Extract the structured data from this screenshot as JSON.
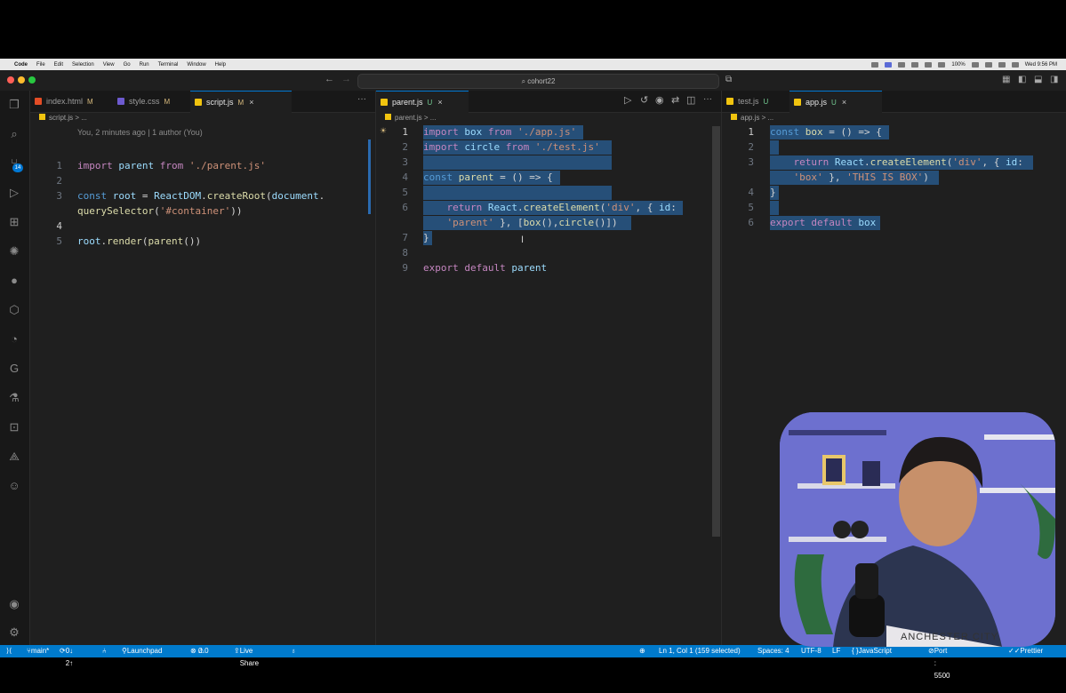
{
  "menubar": {
    "app": "Code",
    "items": [
      "File",
      "Edit",
      "Selection",
      "View",
      "Go",
      "Run",
      "Terminal",
      "Window",
      "Help"
    ],
    "battery": "100%",
    "clock": "Wed 9:56 PM"
  },
  "titlebar": {
    "search": "cohort22"
  },
  "panes": {
    "left": {
      "tabs": [
        {
          "label": "index.html",
          "mark": "M"
        },
        {
          "label": "style.css",
          "mark": "M"
        },
        {
          "label": "script.js",
          "mark": "M"
        }
      ],
      "breadcrumb": "script.js > ...",
      "blame": "You, 2 minutes ago | 1 author (You)",
      "line_numbers": [
        "1",
        "2",
        "3",
        "",
        "4",
        "5"
      ]
    },
    "middle": {
      "tabs": [
        {
          "label": "parent.js",
          "mark": "U"
        }
      ],
      "breadcrumb": "parent.js > ...",
      "line_numbers": [
        "1",
        "2",
        "3",
        "4",
        "5",
        "6",
        "",
        "7",
        "8",
        "9"
      ]
    },
    "right": {
      "tabs": [
        {
          "label": "test.js",
          "mark": "U"
        },
        {
          "label": "app.js",
          "mark": "U"
        }
      ],
      "breadcrumb": "app.js > ...",
      "line_numbers": [
        "1",
        "2",
        "3",
        "",
        "4",
        "5",
        "6"
      ]
    }
  },
  "code": {
    "script": [
      [
        {
          "t": "import ",
          "c": "kw2"
        },
        {
          "t": "parent ",
          "c": "var"
        },
        {
          "t": "from ",
          "c": "kw2"
        },
        {
          "t": "'./parent.js'",
          "c": "str"
        }
      ],
      [],
      [
        {
          "t": "const ",
          "c": "kw"
        },
        {
          "t": "root ",
          "c": "var"
        },
        {
          "t": "= ",
          "c": "op"
        },
        {
          "t": "ReactDOM",
          "c": "var"
        },
        {
          "t": ".",
          "c": "op"
        },
        {
          "t": "createRoot",
          "c": "fn"
        },
        {
          "t": "(",
          "c": "op"
        },
        {
          "t": "document",
          "c": "var"
        },
        {
          "t": ".",
          "c": "op"
        }
      ],
      [
        {
          "t": "querySelector",
          "c": "fn"
        },
        {
          "t": "(",
          "c": "op"
        },
        {
          "t": "'#container'",
          "c": "str"
        },
        {
          "t": "))",
          "c": "op"
        }
      ],
      [],
      [
        {
          "t": "root",
          "c": "var"
        },
        {
          "t": ".",
          "c": "op"
        },
        {
          "t": "render",
          "c": "fn"
        },
        {
          "t": "(",
          "c": "op"
        },
        {
          "t": "parent",
          "c": "fn"
        },
        {
          "t": "())",
          "c": "op"
        }
      ]
    ],
    "parent": [
      [
        {
          "t": "import ",
          "c": "kw2"
        },
        {
          "t": "box ",
          "c": "var"
        },
        {
          "t": "from ",
          "c": "kw2"
        },
        {
          "t": "'./app.js'",
          "c": "str"
        }
      ],
      [
        {
          "t": "import ",
          "c": "kw2"
        },
        {
          "t": "circle ",
          "c": "var"
        },
        {
          "t": "from ",
          "c": "kw2"
        },
        {
          "t": "'./test.js'",
          "c": "str"
        }
      ],
      [],
      [
        {
          "t": "const ",
          "c": "kw"
        },
        {
          "t": "parent ",
          "c": "fn"
        },
        {
          "t": "= () => {",
          "c": "op"
        }
      ],
      [],
      [
        {
          "t": "    return ",
          "c": "kw2"
        },
        {
          "t": "React",
          "c": "var"
        },
        {
          "t": ".",
          "c": "op"
        },
        {
          "t": "createElement",
          "c": "fn"
        },
        {
          "t": "(",
          "c": "op"
        },
        {
          "t": "'div'",
          "c": "str"
        },
        {
          "t": ", { ",
          "c": "op"
        },
        {
          "t": "id",
          "c": "var"
        },
        {
          "t": ":",
          "c": "op"
        }
      ],
      [
        {
          "t": "    'parent'",
          "c": "str"
        },
        {
          "t": " }, [",
          "c": "op"
        },
        {
          "t": "box",
          "c": "fn"
        },
        {
          "t": "(),",
          "c": "op"
        },
        {
          "t": "circle",
          "c": "fn"
        },
        {
          "t": "()])",
          "c": "op"
        }
      ],
      [
        {
          "t": "}",
          "c": "op"
        }
      ],
      [],
      [
        {
          "t": "export ",
          "c": "kw2"
        },
        {
          "t": "default ",
          "c": "kw2"
        },
        {
          "t": "parent",
          "c": "var"
        }
      ]
    ],
    "app": [
      [
        {
          "t": "const ",
          "c": "kw"
        },
        {
          "t": "box ",
          "c": "fn"
        },
        {
          "t": "= () => {",
          "c": "op"
        }
      ],
      [],
      [
        {
          "t": "    return ",
          "c": "kw2"
        },
        {
          "t": "React",
          "c": "var"
        },
        {
          "t": ".",
          "c": "op"
        },
        {
          "t": "createElement",
          "c": "fn"
        },
        {
          "t": "(",
          "c": "op"
        },
        {
          "t": "'div'",
          "c": "str"
        },
        {
          "t": ", { ",
          "c": "op"
        },
        {
          "t": "id",
          "c": "var"
        },
        {
          "t": ":",
          "c": "op"
        }
      ],
      [
        {
          "t": "    'box'",
          "c": "str"
        },
        {
          "t": " }, ",
          "c": "op"
        },
        {
          "t": "'THIS IS BOX'",
          "c": "str"
        },
        {
          "t": ")",
          "c": "op"
        }
      ],
      [
        {
          "t": "}",
          "c": "op"
        }
      ],
      [],
      [
        {
          "t": "export ",
          "c": "kw2"
        },
        {
          "t": "default ",
          "c": "kw2"
        },
        {
          "t": "box",
          "c": "var"
        }
      ]
    ]
  },
  "statusbar": {
    "branch": "main*",
    "sync": "0↓ 2↑",
    "launchpad": "Launchpad",
    "problems": "0",
    "warnings": "0",
    "liveshare": "Live Share",
    "position": "Ln 1, Col 1 (159 selected)",
    "spaces": "Spaces: 4",
    "encoding": "UTF-8",
    "eol": "LF",
    "language": "JavaScript",
    "port": "Port : 5500",
    "formatter": "Prettier"
  },
  "webcam": {
    "shirt_text": "ANCHESTER CITY"
  },
  "colors": {
    "accent": "#007acc",
    "selection": "#264f78",
    "editor_bg": "#1f1f1f"
  }
}
